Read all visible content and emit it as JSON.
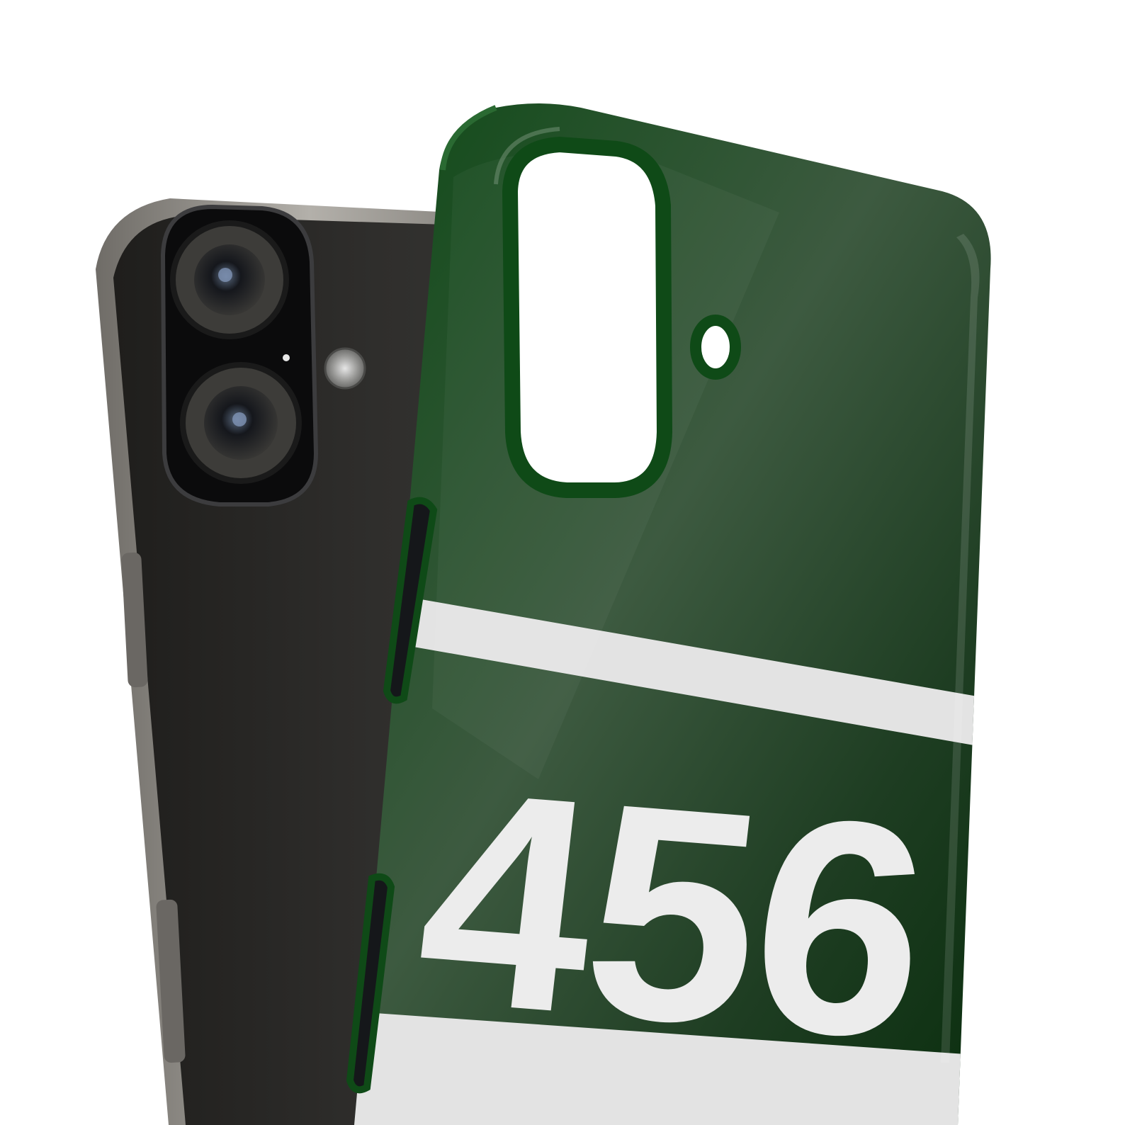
{
  "case": {
    "number": "456",
    "color": "#0d3a12",
    "stripe_color": "#e3e3e3"
  },
  "phone": {
    "color": "#2b2a28",
    "frame_color": "#8d8a84"
  },
  "background": "#ffffff"
}
